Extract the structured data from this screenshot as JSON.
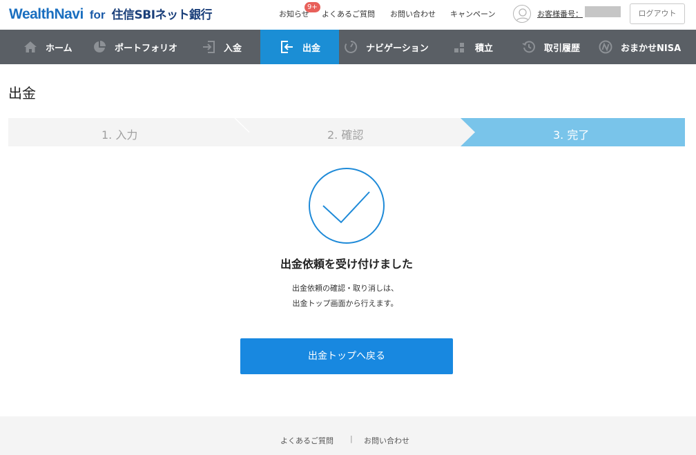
{
  "header": {
    "logo_brand": "WealthNavi",
    "logo_for": "for",
    "logo_bank": "住信SBIネット銀行",
    "links": {
      "notice": "お知らせ",
      "faq": "よくあるご質問",
      "contact": "お問い合わせ",
      "campaign": "キャンペーン"
    },
    "notice_badge": "9+",
    "customer_number_label": "お客様番号：",
    "logout_label": "ログアウト"
  },
  "nav": {
    "items": [
      {
        "label": "ホーム",
        "icon": "home-icon"
      },
      {
        "label": "ポートフォリオ",
        "icon": "pie-chart-icon"
      },
      {
        "label": "入金",
        "icon": "deposit-icon"
      },
      {
        "label": "出金",
        "icon": "withdraw-icon",
        "active": true
      },
      {
        "label": "ナビゲーション",
        "icon": "navigation-icon"
      },
      {
        "label": "積立",
        "icon": "blocks-icon"
      },
      {
        "label": "取引履歴",
        "icon": "history-icon"
      },
      {
        "label": "おまかせNISA",
        "icon": "nisa-icon"
      }
    ]
  },
  "page": {
    "title": "出金"
  },
  "steps": [
    {
      "label": "1. 入力"
    },
    {
      "label": "2. 確認"
    },
    {
      "label": "3. 完了",
      "current": true
    }
  ],
  "result": {
    "title": "出金依頼を受け付けました",
    "message_line1": "出金依頼の確認・取り消しは、",
    "message_line2": "出金トップ画面から行えます。",
    "button_label": "出金トップへ戻る"
  },
  "footer": {
    "faq": "よくあるご質問",
    "separator": "|",
    "contact": "お問い合わせ"
  },
  "colors": {
    "brand_blue": "#1a6fc0",
    "nav_bg": "#5a5f65",
    "nav_active": "#1b8ed5",
    "step_current": "#79c4ea",
    "button": "#1888e0",
    "badge": "#e8605a"
  }
}
